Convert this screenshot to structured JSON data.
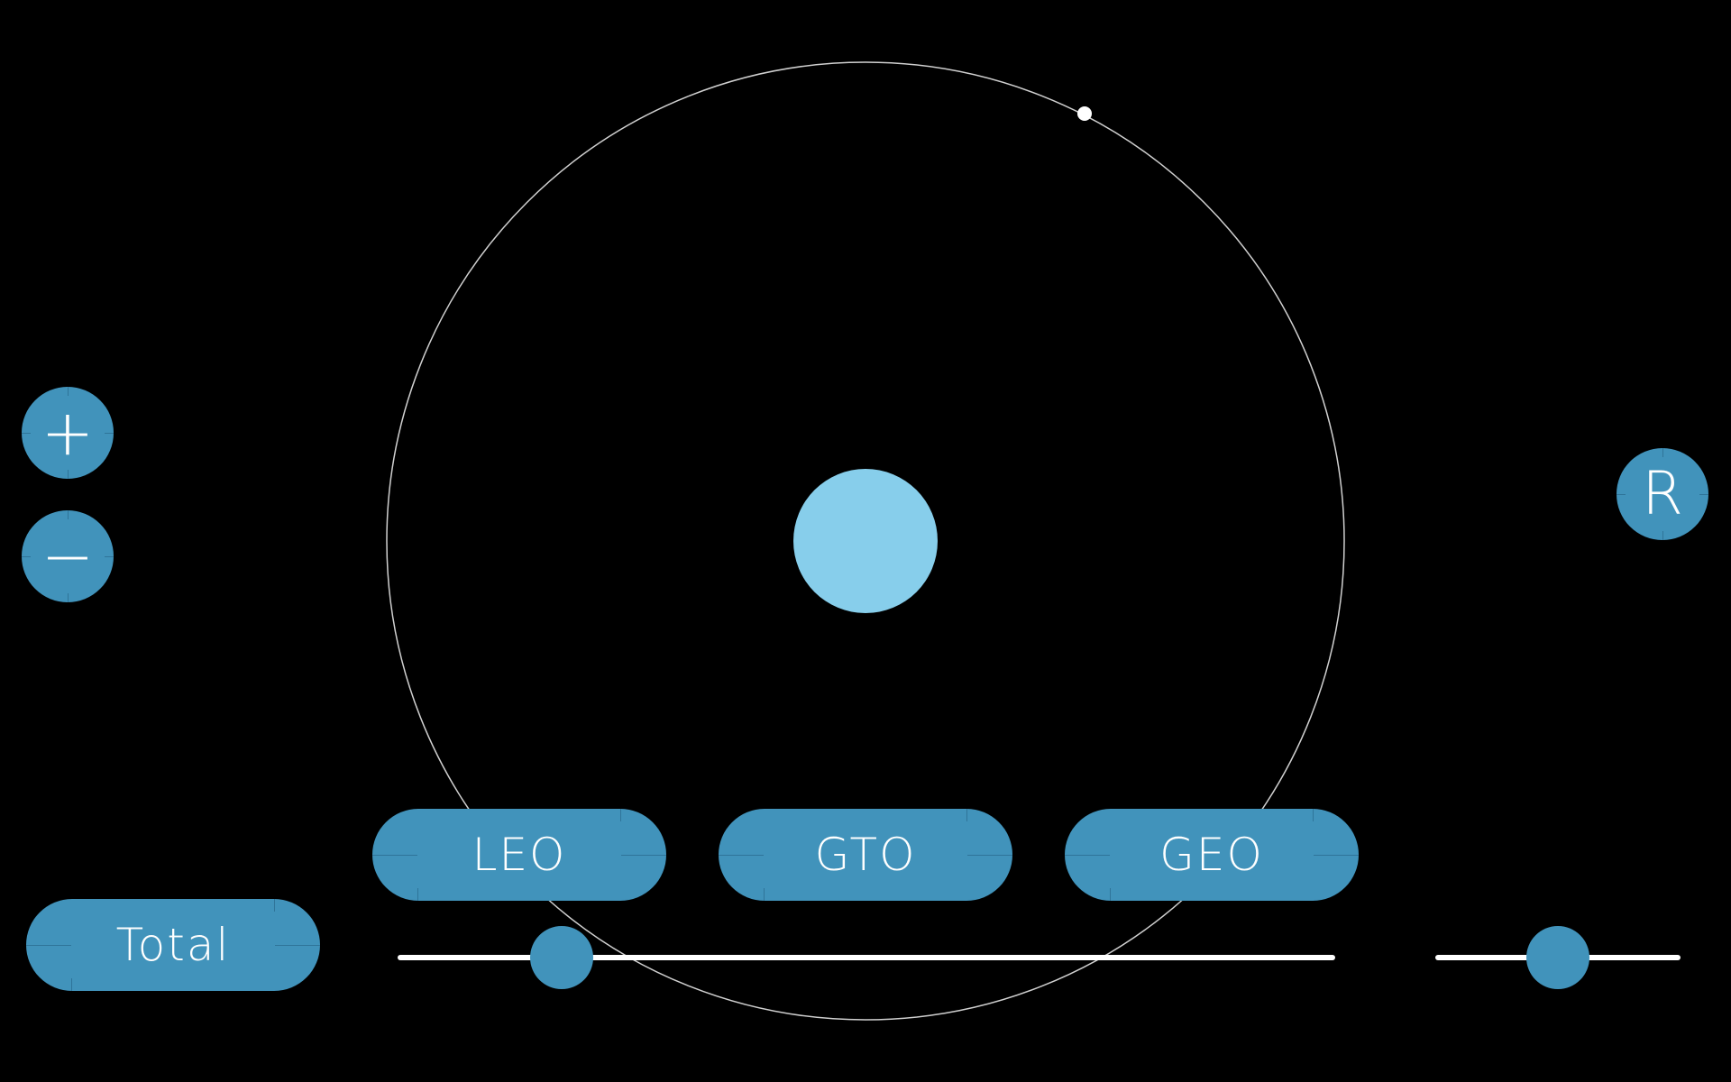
{
  "colors": {
    "background": "#000000",
    "button": "#4193bb",
    "button_text": "#ffffff",
    "planet": "#87ceeb",
    "orbit": "#d0d0d0",
    "satellite": "#ffffff",
    "slider_track": "#ffffff"
  },
  "zoom_controls": {
    "zoom_in_icon": "plus-icon",
    "zoom_in_glyph": "+",
    "zoom_out_icon": "minus-icon",
    "zoom_out_glyph": "−"
  },
  "reset_button": {
    "label": "R"
  },
  "orbit_buttons": [
    {
      "label": "LEO"
    },
    {
      "label": "GTO"
    },
    {
      "label": "GEO"
    }
  ],
  "total_button": {
    "label": "Total"
  },
  "sliders": {
    "main_slider_value": 0.175,
    "secondary_slider_value": 0.5
  }
}
